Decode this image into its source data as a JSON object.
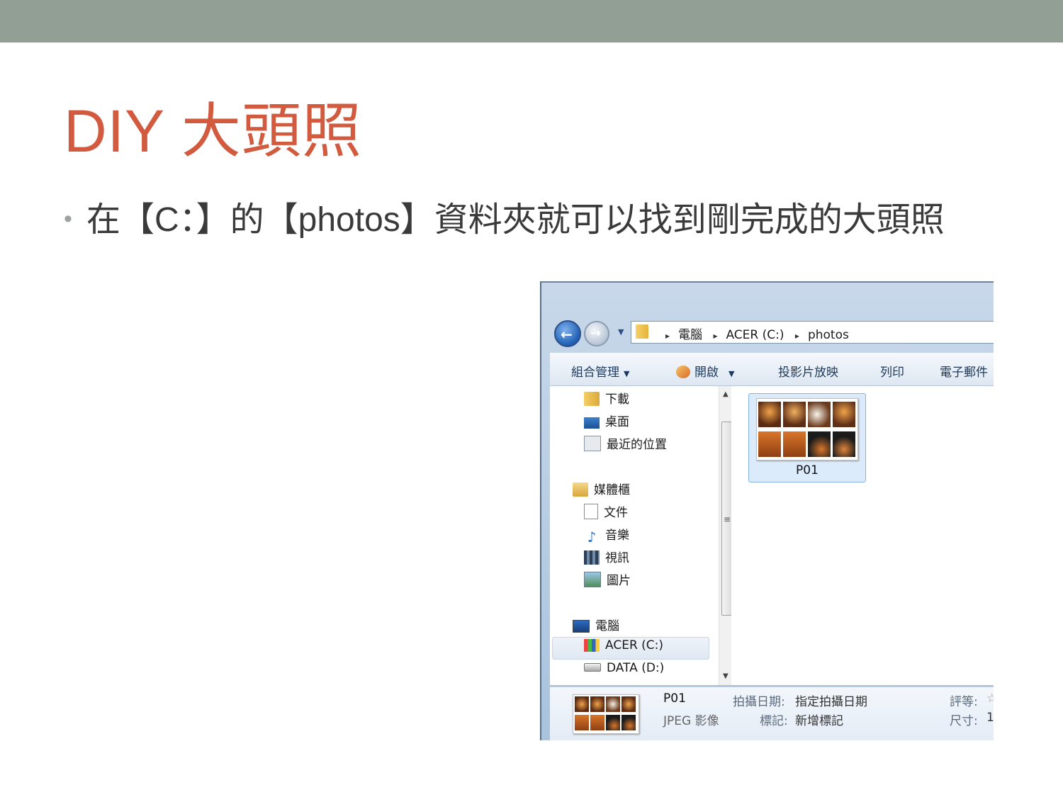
{
  "slide": {
    "title": "DIY 大頭照",
    "bullet_marker": "•",
    "bullet": "在【C：】的【photos】資料夾就可以找到剛完成的大頭照"
  },
  "explorer": {
    "breadcrumbs": [
      "電腦",
      "ACER (C:)",
      "photos"
    ],
    "crumb_separator": "▸",
    "toolbar": {
      "organize": "組合管理",
      "open": "開啟",
      "slideshow": "投影片放映",
      "print": "列印",
      "email": "電子郵件"
    },
    "nav_items": {
      "downloads": "下載",
      "desktop": "桌面",
      "recent": "最近的位置",
      "libraries": "媒體櫃",
      "documents": "文件",
      "music": "音樂",
      "videos": "視訊",
      "pictures": "圖片",
      "computer": "電腦",
      "drive_c": "ACER (C:)",
      "drive_d": "DATA (D:)"
    },
    "file": {
      "name": "P01",
      "type": "JPEG 影像"
    },
    "details": {
      "date_label": "拍攝日期:",
      "date_value": "指定拍攝日期",
      "tags_label": "標記:",
      "tags_value": "新增標記",
      "rating_label": "評等:",
      "rating_value": "☆",
      "size_label": "尺寸:",
      "size_value": "1"
    }
  },
  "colors": {
    "top_bar": "#919f95",
    "title": "#d25a3f",
    "body_text": "#3a3a3a"
  }
}
